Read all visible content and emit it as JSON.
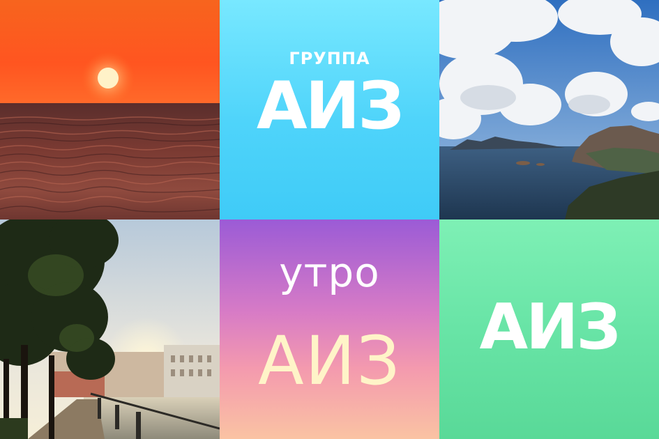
{
  "tiles": [
    {
      "kind": "photo",
      "subject": "sunset over sea"
    },
    {
      "kind": "logo",
      "label": "ГРУППА",
      "brand": "АИЗ",
      "background": "#5ED8FB"
    },
    {
      "kind": "photo",
      "subject": "coastal cliffs under cloudy sky"
    },
    {
      "kind": "photo",
      "subject": "city embankment at sunrise"
    },
    {
      "kind": "logo",
      "label": "утро",
      "brand": "АИЗ",
      "background": "#D77BC6"
    },
    {
      "kind": "logo",
      "brand": "АИЗ",
      "background": "#68E4A6"
    }
  ],
  "colors": {
    "sunset_sky": "#FF5A1E",
    "sun": "#FFF2C8",
    "sea_dark": "#3A1E22",
    "brand_text": "#FFFFFF",
    "morning_brand_text": "#FFF4C8"
  }
}
